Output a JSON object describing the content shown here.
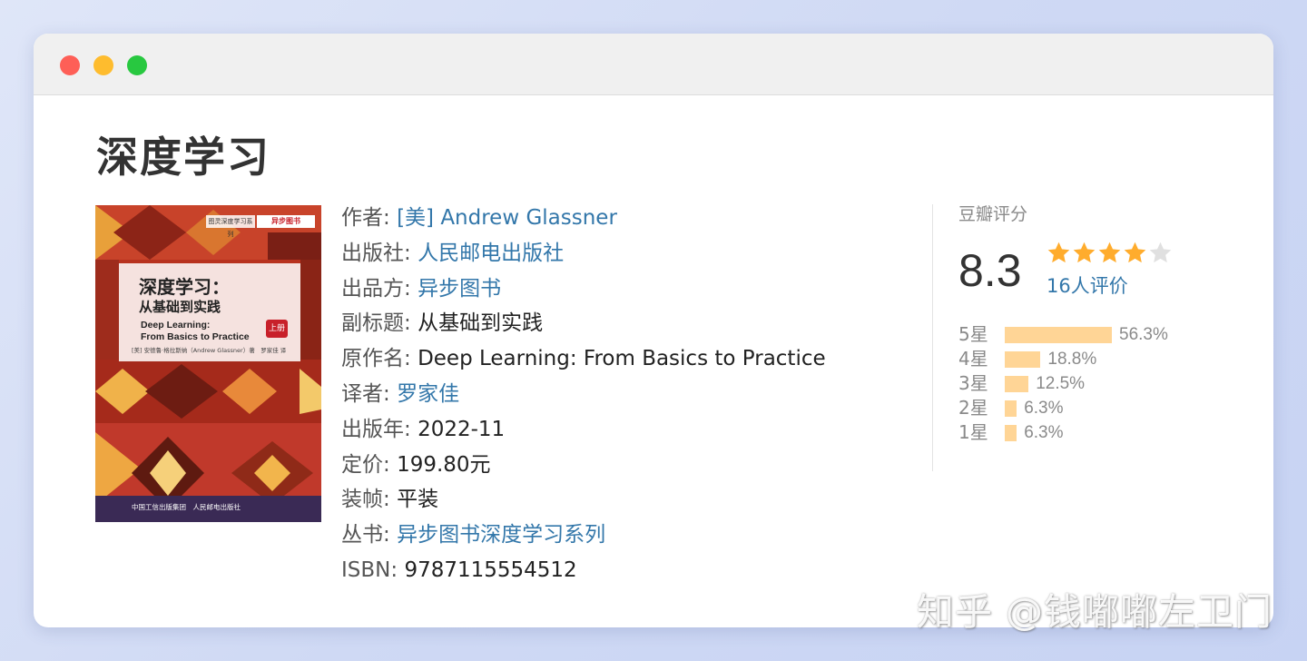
{
  "page_title": "深度学习",
  "cover": {
    "title": "深度学习：",
    "subtitle": "从基础到实践",
    "en_line1": "Deep Learning:",
    "en_line2": "From Basics to Practice",
    "badge": "上册",
    "authors": "[美] 安德鲁·格拉斯纳（Andrew Glassner）著　罗家佳 译",
    "series": "图灵深度学习系列",
    "brand": "异步图书",
    "publisher": "中国工信出版集团　人民邮电出版社"
  },
  "info": {
    "author_label": "作者:",
    "author_value": "[美] Andrew Glassner",
    "press_label": "出版社:",
    "press_value": "人民邮电出版社",
    "producer_label": "出品方:",
    "producer_value": "异步图书",
    "subtitle_label": "副标题:",
    "subtitle_value": "从基础到实践",
    "original_label": "原作名:",
    "original_value": "Deep Learning: From Basics to Practice",
    "translator_label": "译者:",
    "translator_value": "罗家佳",
    "year_label": "出版年:",
    "year_value": "2022-11",
    "price_label": "定价:",
    "price_value": "199.80元",
    "binding_label": "装帧:",
    "binding_value": "平装",
    "series_label": "丛书:",
    "series_value": "异步图书深度学习系列",
    "isbn_label": "ISBN:",
    "isbn_value": "9787115554512"
  },
  "rating": {
    "heading": "豆瓣评分",
    "score": "8.3",
    "stars_filled": 4,
    "stars_total": 5,
    "count": "16人评价",
    "distribution": [
      {
        "label": "5星",
        "pct": "56.3%",
        "value": 56.3
      },
      {
        "label": "4星",
        "pct": "18.8%",
        "value": 18.8
      },
      {
        "label": "3星",
        "pct": "12.5%",
        "value": 12.5
      },
      {
        "label": "2星",
        "pct": "6.3%",
        "value": 6.3
      },
      {
        "label": "1星",
        "pct": "6.3%",
        "value": 6.3
      }
    ]
  },
  "watermark": "知乎 @钱嘟嘟左卫门",
  "colors": {
    "link": "#3377aa",
    "star_filled": "#ffac2d",
    "star_empty": "#e0e0e0",
    "bar": "#ffd596"
  }
}
